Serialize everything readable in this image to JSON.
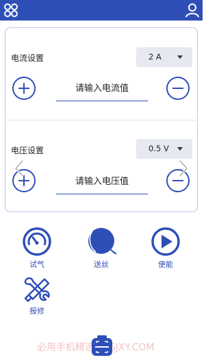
{
  "current": {
    "label": "电流设置",
    "unit_value": "2 A",
    "placeholder": "请输入电流值"
  },
  "voltage": {
    "label": "电压设置",
    "unit_value": "0.5 V",
    "placeholder": "请输入电压值"
  },
  "tools": [
    {
      "label": "试气",
      "icon": "gauge-icon"
    },
    {
      "label": "送丝",
      "icon": "wire-spool-icon"
    },
    {
      "label": "使能",
      "icon": "play-icon"
    },
    {
      "label": "报修",
      "icon": "repair-tools-icon"
    }
  ],
  "watermark": "必用手机精选  BYSJXY.COM",
  "colors": {
    "accent": "#2f4fb8",
    "panel_border": "#b9c6e8",
    "select_bg": "#e6e9ef"
  }
}
